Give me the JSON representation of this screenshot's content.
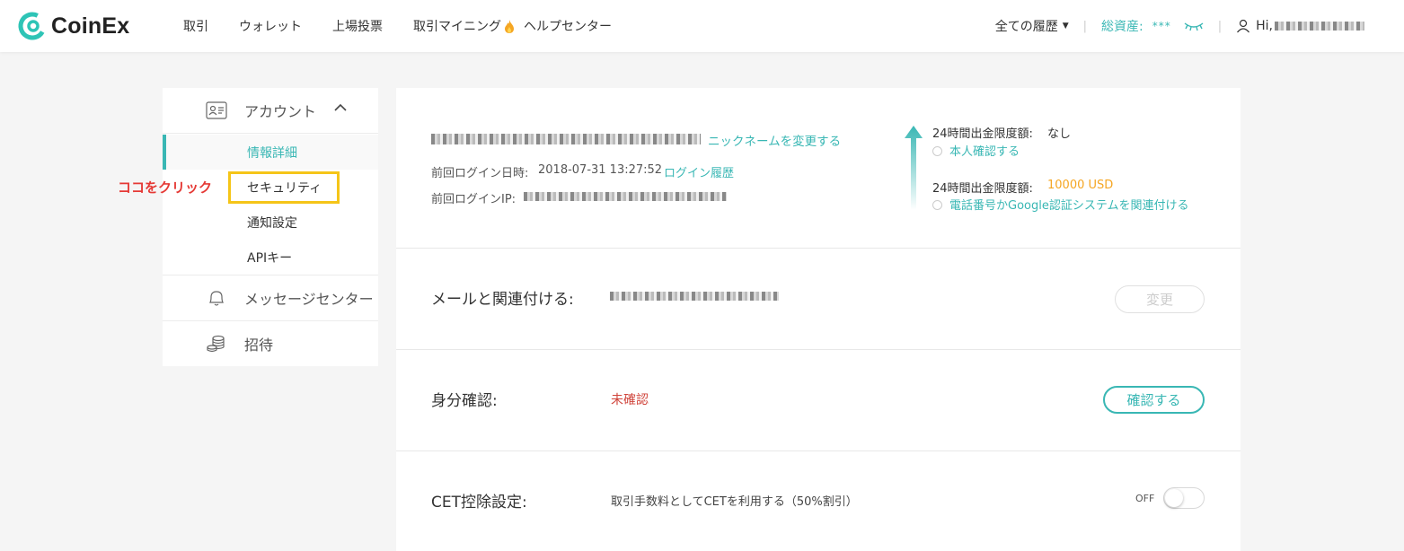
{
  "header": {
    "logo_text": "CoinEx",
    "nav": [
      "取引",
      "ウォレット",
      "上場投票",
      "取引マイニング",
      "ヘルプセンター"
    ],
    "history_label": "全ての履歴",
    "total_assets_label": "総資産:",
    "total_assets_value": "***",
    "greeting": "Hi,"
  },
  "sidebar": {
    "account_label": "アカウント",
    "items": [
      "情報詳細",
      "セキュリティ",
      "通知設定",
      "APIキー"
    ],
    "message_center_label": "メッセージセンター",
    "invite_label": "招待"
  },
  "annotation": {
    "click_here": "ココをクリック"
  },
  "profile": {
    "change_nickname": "ニックネームを変更する",
    "last_login_time_label": "前回ログイン日時:",
    "last_login_time": "2018-07-31 13:27:52",
    "login_history": "ログイン履歴",
    "last_login_ip_label": "前回ログインIP:",
    "limit_label_1": "24時間出金限度額:",
    "limit_value_1": "なし",
    "verify_link": "本人確認する",
    "limit_label_2": "24時間出金限度額:",
    "limit_value_2": "10000 USD",
    "bind_2fa_link": "電話番号かGoogle認証システムを関連付ける"
  },
  "email_row": {
    "label": "メールと関連付ける:",
    "button": "変更"
  },
  "identity_row": {
    "label": "身分確認:",
    "status": "未確認",
    "button": "確認する"
  },
  "cet_row": {
    "label": "CET控除設定:",
    "description": "取引手数料としてCETを利用する（50%割引）",
    "toggle_label": "OFF"
  },
  "colors": {
    "accent": "#39b7b4",
    "warning": "#f5a623",
    "error": "#d0443b",
    "highlight": "#f5c518"
  }
}
